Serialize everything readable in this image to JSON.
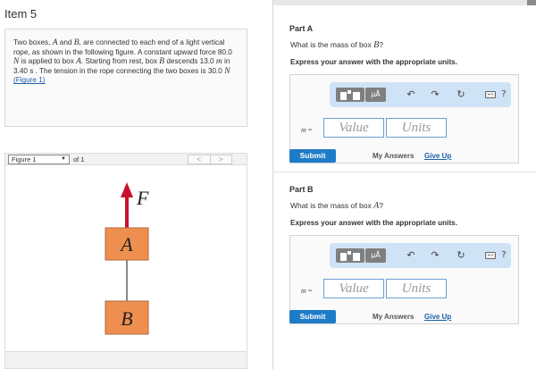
{
  "item_title": "Item 5",
  "problem": {
    "segments": [
      {
        "t": "Two boxes, ",
        "i": false
      },
      {
        "t": "A",
        "i": true
      },
      {
        "t": " and ",
        "i": false
      },
      {
        "t": "B",
        "i": true
      },
      {
        "t": ", are connected to each end of a light vertical rope, as shown in the following figure. A constant upward force 80.0 ",
        "i": false
      },
      {
        "t": "N",
        "i": true
      },
      {
        "t": " is applied to box ",
        "i": false
      },
      {
        "t": "A",
        "i": true
      },
      {
        "t": ". Starting from rest, box ",
        "i": false
      },
      {
        "t": "B",
        "i": true
      },
      {
        "t": " descends 13.0 ",
        "i": false
      },
      {
        "t": "m",
        "i": true
      },
      {
        "t": " in 3.40 s . The tension in the rope connecting the two boxes is 30.0 ",
        "i": false
      },
      {
        "t": "N",
        "i": true
      },
      {
        "t": " ",
        "i": false
      }
    ],
    "figure_link": "(Figure 1)"
  },
  "figure_nav": {
    "selected": "Figure 1",
    "of_text": "of 1",
    "prev": "<",
    "next": ">"
  },
  "figure": {
    "force_label": "F",
    "box_a_label": "A",
    "box_b_label": "B",
    "colors": {
      "arrow": "#c8102e",
      "box": "#ef8f4f",
      "box_border": "#b06a3a",
      "rope": "#888888"
    }
  },
  "parts": [
    {
      "label": "Part A",
      "question_pre": "What is the mass of box ",
      "question_var": "B",
      "question_post": "?",
      "instruction": "Express your answer with the appropriate units.",
      "var_label": "m",
      "value_placeholder": "Value",
      "units_placeholder": "Units",
      "submit": "Submit",
      "my_answers": "My Answers",
      "give_up": "Give Up"
    },
    {
      "label": "Part B",
      "question_pre": "What is the mass of box ",
      "question_var": "A",
      "question_post": "?",
      "instruction": "Express your answer with the appropriate units.",
      "var_label": "m",
      "value_placeholder": "Value",
      "units_placeholder": "Units",
      "submit": "Submit",
      "my_answers": "My Answers",
      "give_up": "Give Up"
    }
  ],
  "toolbar": {
    "mu_button": "μÅ",
    "undo_icon": "↶",
    "redo_icon": "↷",
    "reset_icon": "↻",
    "help_icon": "?"
  },
  "accent_color": "#1e7bc7"
}
